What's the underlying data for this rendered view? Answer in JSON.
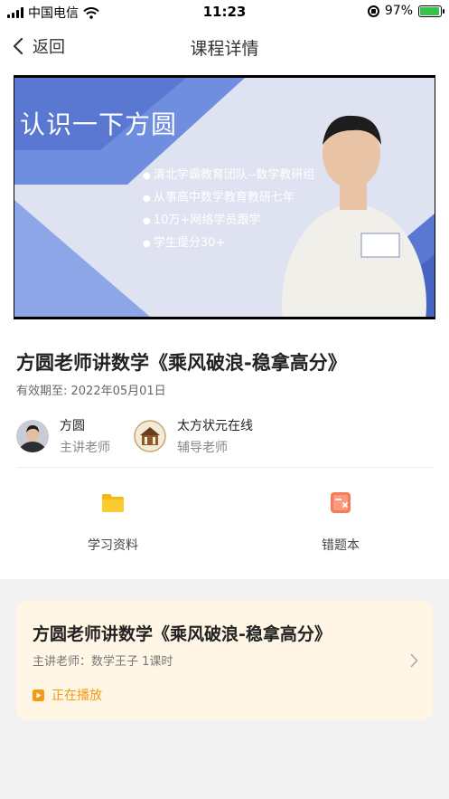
{
  "status_bar": {
    "carrier": "中国电信",
    "time": "11:23",
    "battery": "97%",
    "battery_level": 0.97
  },
  "nav": {
    "back_label": "返回",
    "title": "课程详情"
  },
  "video": {
    "slide_title": "认识一下方圆",
    "bullets": [
      "清北学霸教育团队--数学教研组",
      "从事高中数学教育教研七年",
      "10万+网络学员跟学",
      "学生提分30+"
    ]
  },
  "course": {
    "title": "方圆老师讲数学《乘风破浪-稳拿高分》",
    "valid_until": "有效期至: 2022年05月01日"
  },
  "teachers": [
    {
      "name": "方圆",
      "role": "主讲老师"
    },
    {
      "name": "太方状元在线",
      "role": "辅导老师"
    }
  ],
  "tools": [
    {
      "label": "学习资料",
      "icon": "folder-icon",
      "color": "#f5b914"
    },
    {
      "label": "错题本",
      "icon": "wrong-questions-icon",
      "color": "#f57b5a"
    }
  ],
  "lesson_card": {
    "title": "方圆老师讲数学《乘风破浪-稳拿高分》",
    "meta": "主讲老师：数学王子   1课时",
    "status": "正在播放",
    "accent": "#f29a13"
  }
}
